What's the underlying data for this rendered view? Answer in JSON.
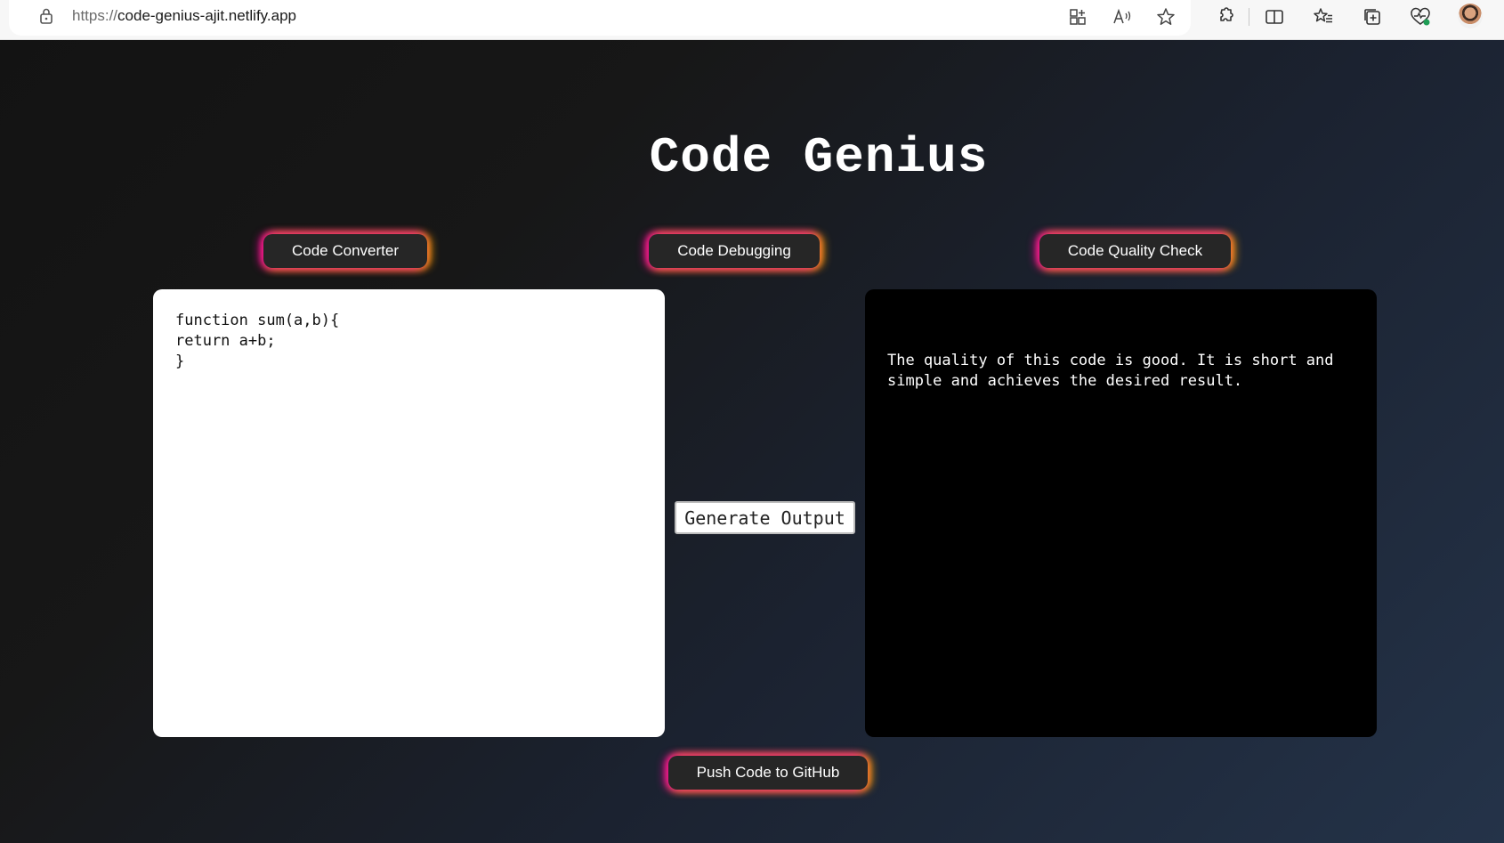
{
  "browser": {
    "url_scheme": "https://",
    "url_host": "code-genius-ajit.netlify.app",
    "icons": [
      "lock-icon",
      "app-available-icon",
      "read-aloud-icon",
      "favorite-star-icon",
      "extensions-icon",
      "split-screen-icon",
      "favorites-icon",
      "collections-icon",
      "browser-essentials-icon",
      "profile-avatar"
    ]
  },
  "app": {
    "title": "Code Genius",
    "tabs": {
      "converter": "Code Converter",
      "debugging": "Code Debugging",
      "quality": "Code Quality Check"
    },
    "input_code": [
      "function sum(a,b){",
      "return a+b;",
      "}"
    ],
    "generate_label": "Generate Output",
    "output_text": "The quality of this code is good. It is short and simple and achieves the desired result.",
    "push_label": "Push Code to GitHub"
  },
  "colors": {
    "glow_pink": "#ff00aa",
    "glow_orange": "#ffaa00",
    "button_bg": "#262626",
    "output_bg": "#000000",
    "input_bg": "#ffffff"
  }
}
